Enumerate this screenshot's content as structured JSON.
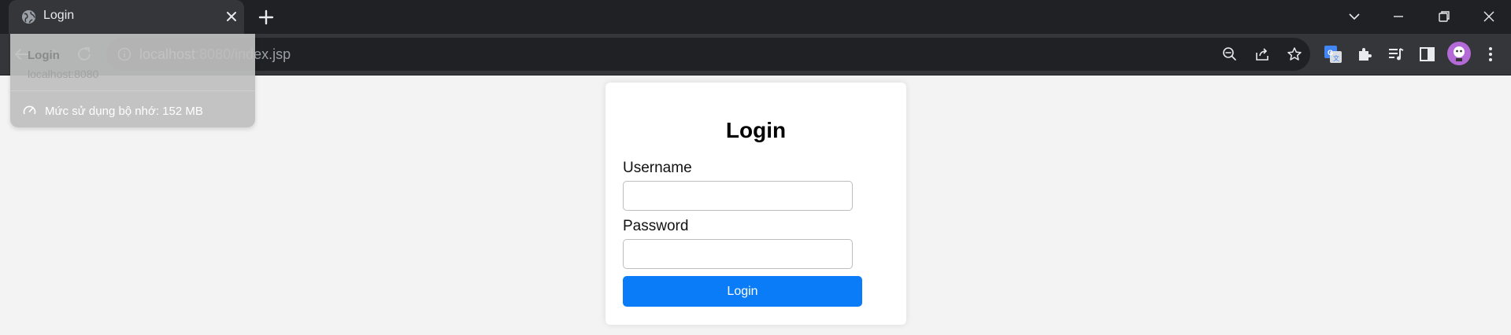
{
  "browser": {
    "tab": {
      "title": "Login"
    },
    "omnibox": {
      "host": "localhost",
      "path": ":8080/index.jsp"
    },
    "hover_card": {
      "title": "Login",
      "host": "localhost:8080",
      "memory": "Mức sử dụng bộ nhớ: 152 MB"
    },
    "icons": {
      "favicon": "globe-icon",
      "back": "back-arrow-icon",
      "forward": "forward-arrow-icon",
      "reload": "reload-icon",
      "zoom": "zoom-out-icon",
      "share": "share-icon",
      "bookmark": "star-icon",
      "translate": "google-translate-icon",
      "extensions": "puzzle-icon",
      "media": "media-queue-icon",
      "side_panel": "side-panel-icon",
      "menu": "kebab-menu-icon"
    },
    "colors": {
      "titlebar": "#202124",
      "toolbar": "#35363a",
      "omnibox": "#202124",
      "avatar": "#b36ad6"
    }
  },
  "page": {
    "background": "#f3f3f3",
    "form": {
      "heading": "Login",
      "username_label": "Username",
      "username_value": "",
      "password_label": "Password",
      "password_value": "",
      "submit_label": "Login",
      "submit_color": "#0a7cf7"
    }
  }
}
